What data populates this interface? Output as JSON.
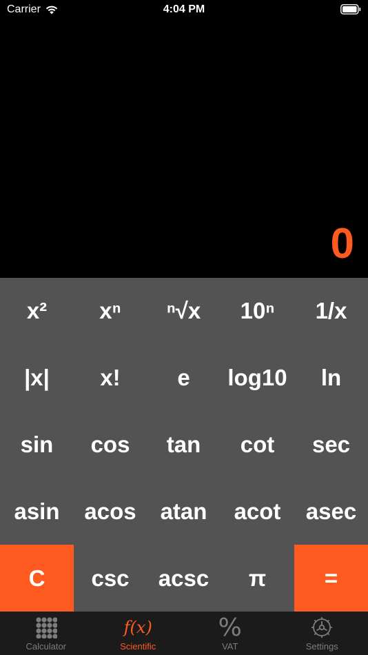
{
  "status_bar": {
    "carrier": "Carrier",
    "time": "4:04 PM"
  },
  "display": {
    "value": "0",
    "color": "#ff5a20"
  },
  "keypad": {
    "rows": [
      [
        "x²",
        "xⁿ",
        "ⁿ√x",
        "10ⁿ",
        "1/x"
      ],
      [
        "|x|",
        "x!",
        "e",
        "log10",
        "ln"
      ],
      [
        "sin",
        "cos",
        "tan",
        "cot",
        "sec"
      ],
      [
        "asin",
        "acos",
        "atan",
        "acot",
        "asec"
      ],
      [
        "C",
        "csc",
        "acsc",
        "π",
        "="
      ]
    ],
    "accent_color": "#ff5a20",
    "background": "#535353"
  },
  "tabbar": {
    "tabs": [
      {
        "label": "Calculator",
        "icon": "grid-icon"
      },
      {
        "label": "Scientific",
        "icon": "fx-icon",
        "active": true
      },
      {
        "label": "VAT",
        "icon": "percent-icon"
      },
      {
        "label": "Settings",
        "icon": "gear-icon"
      }
    ],
    "fx_symbol": "f(x)",
    "vat_symbol": "%"
  }
}
